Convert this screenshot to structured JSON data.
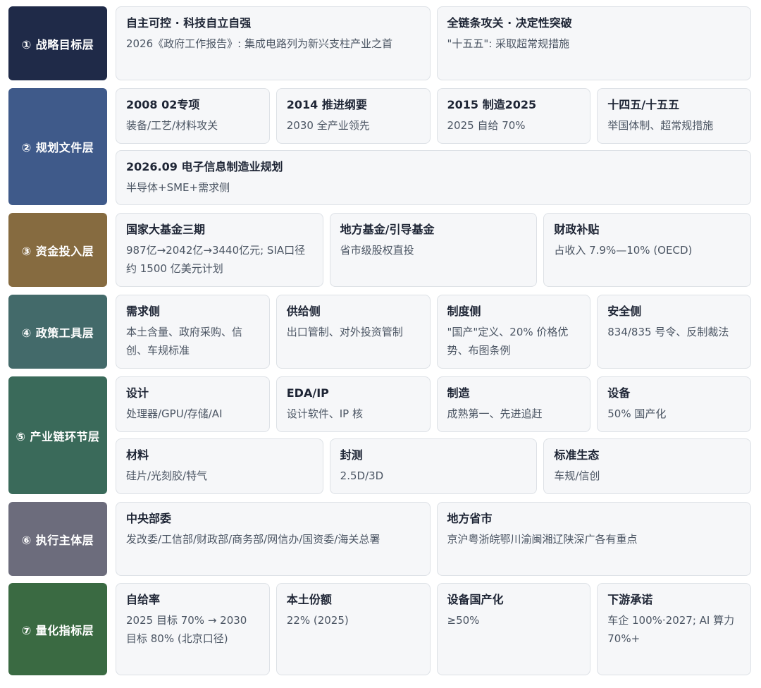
{
  "layers": [
    {
      "label": "① 战略目标层",
      "color": "#1f2a48",
      "rows": [
        [
          {
            "title": "自主可控 · 科技自立自强",
            "desc": "2026《政府工作报告》: 集成电路列为新兴支柱产业之首"
          },
          {
            "title": "全链条攻关 · 决定性突破",
            "desc": "\"十五五\": 采取超常规措施"
          }
        ]
      ]
    },
    {
      "label": "② 规划文件层",
      "color": "#3f5a8a",
      "rows": [
        [
          {
            "title": "2008 02专项",
            "desc": "装备/工艺/材料攻关"
          },
          {
            "title": "2014 推进纲要",
            "desc": "2030 全产业领先"
          },
          {
            "title": "2015 制造2025",
            "desc": "2025 自给 70%"
          },
          {
            "title": "十四五/十五五",
            "desc": "举国体制、超常规措施"
          }
        ],
        [
          {
            "title": "2026.09 电子信息制造业规划",
            "desc": "半导体+SME+需求侧"
          }
        ]
      ]
    },
    {
      "label": "③ 资金投入层",
      "color": "#866b40",
      "rows": [
        [
          {
            "title": "国家大基金三期",
            "desc": "987亿→2042亿→3440亿元; SIA口径约 1500 亿美元计划"
          },
          {
            "title": "地方基金/引导基金",
            "desc": "省市级股权直投"
          },
          {
            "title": "财政补贴",
            "desc": "占收入 7.9%—10% (OECD)"
          }
        ]
      ]
    },
    {
      "label": "④ 政策工具层",
      "color": "#436a6a",
      "rows": [
        [
          {
            "title": "需求侧",
            "desc": "本土含量、政府采购、信创、车规标准"
          },
          {
            "title": "供给侧",
            "desc": "出口管制、对外投资管制"
          },
          {
            "title": "制度侧",
            "desc": "\"国产\"定义、20% 价格优势、布图条例"
          },
          {
            "title": "安全侧",
            "desc": "834/835 号令、反制裁法"
          }
        ]
      ]
    },
    {
      "label": "⑤ 产业链环节层",
      "color": "#3a6a5a",
      "rows": [
        [
          {
            "title": "设计",
            "desc": "处理器/GPU/存储/AI"
          },
          {
            "title": "EDA/IP",
            "desc": "设计软件、IP 核"
          },
          {
            "title": "制造",
            "desc": "成熟第一、先进追赶"
          },
          {
            "title": "设备",
            "desc": "50% 国产化"
          }
        ],
        [
          {
            "title": "材料",
            "desc": "硅片/光刻胶/特气"
          },
          {
            "title": "封测",
            "desc": "2.5D/3D"
          },
          {
            "title": "标准生态",
            "desc": "车规/信创"
          }
        ]
      ]
    },
    {
      "label": "⑥ 执行主体层",
      "color": "#6c6c7c",
      "rows": [
        [
          {
            "title": "中央部委",
            "desc": "发改委/工信部/财政部/商务部/网信办/国资委/海关总署"
          },
          {
            "title": "地方省市",
            "desc": "京沪粤浙皖鄂川渝闽湘辽陕深广各有重点"
          }
        ]
      ]
    },
    {
      "label": "⑦ 量化指标层",
      "color": "#3a6a42",
      "rows": [
        [
          {
            "title": "自给率",
            "desc": "2025 目标 70% → 2030 目标 80% (北京口径)"
          },
          {
            "title": "本土份额",
            "desc": "22% (2025)"
          },
          {
            "title": "设备国产化",
            "desc": "≥50%"
          },
          {
            "title": "下游承诺",
            "desc": "车企 100%·2027; AI 算力 70%+"
          }
        ]
      ]
    }
  ]
}
